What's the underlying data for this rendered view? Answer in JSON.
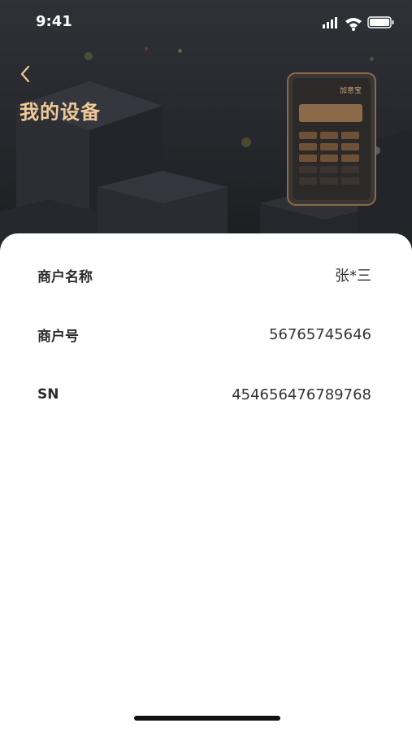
{
  "status_bar": {
    "time": "9:41"
  },
  "header": {
    "title": "我的设备"
  },
  "device_logo": {
    "brand": "加意宝"
  },
  "details": [
    {
      "label": "商户名称",
      "value": "张*三"
    },
    {
      "label": "商户号",
      "value": "56765745646"
    },
    {
      "label": "SN",
      "value": "454656476789768"
    }
  ],
  "colors": {
    "accent": "#f0c997",
    "hero_bg": "#2b2d33",
    "sheet_bg": "#ffffff"
  }
}
